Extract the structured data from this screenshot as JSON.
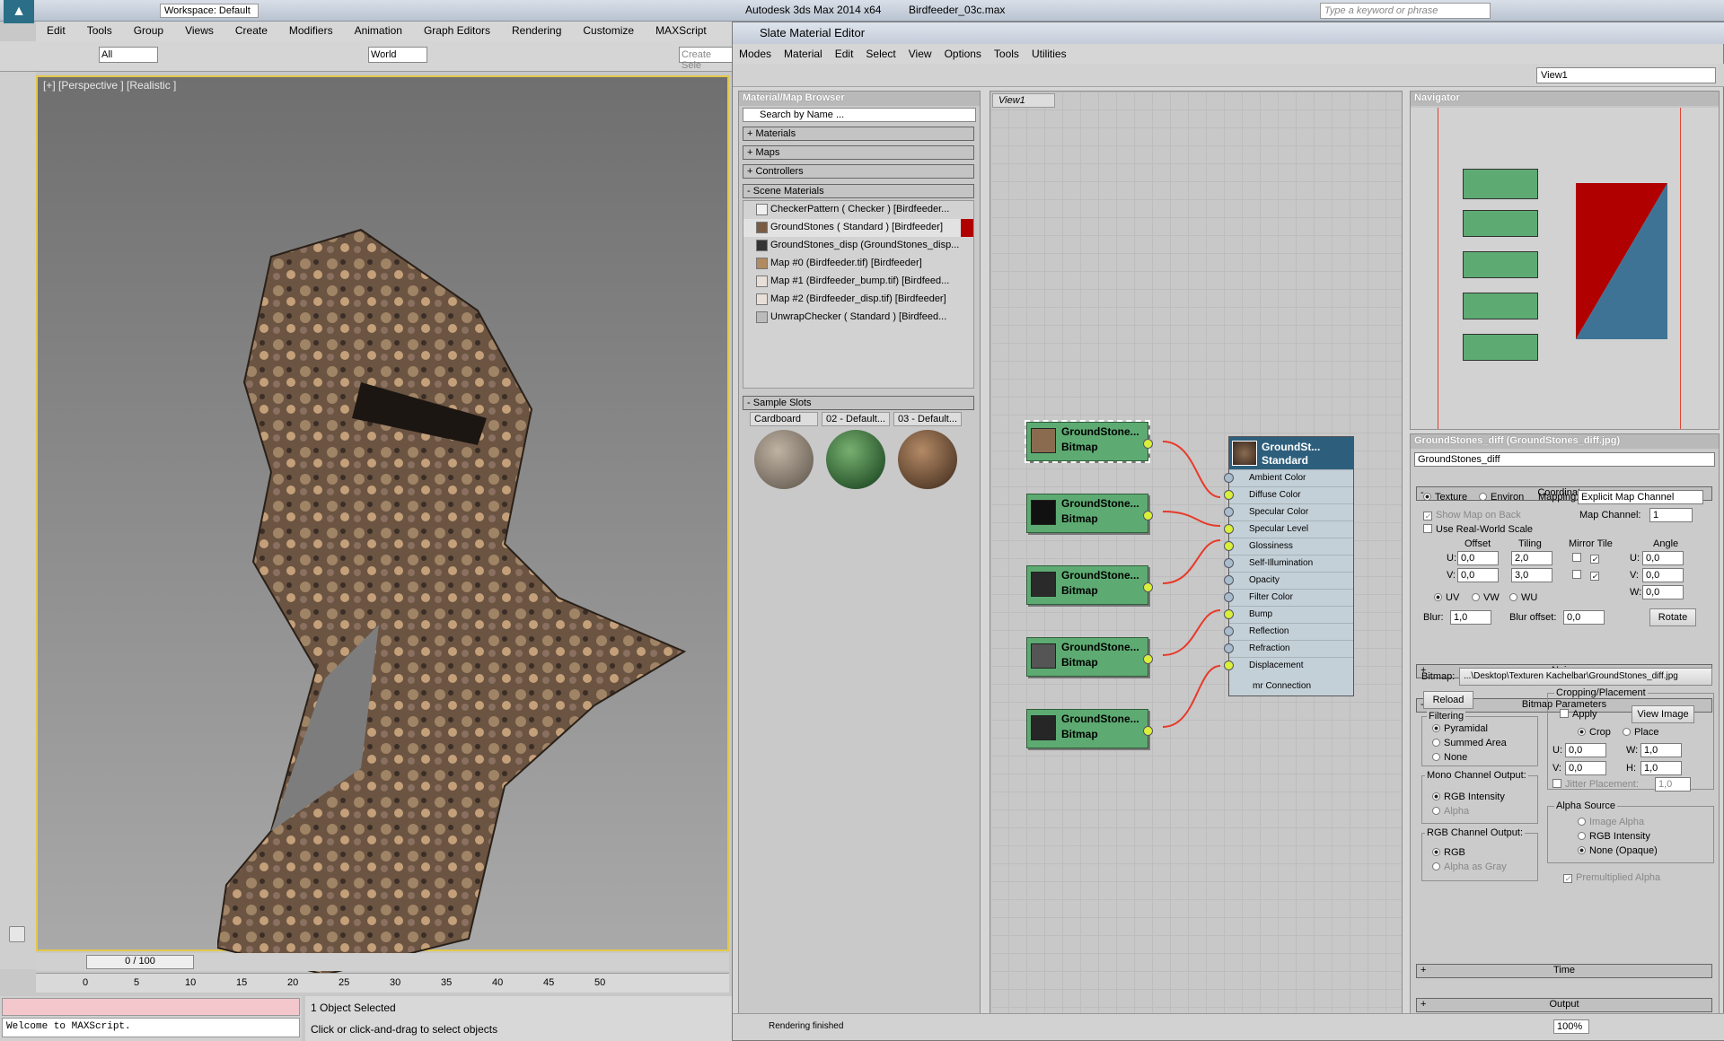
{
  "app": {
    "title": "Autodesk 3ds Max 2014 x64",
    "file": "Birdfeeder_03c.max",
    "workspace": "Workspace: Default",
    "search_placeholder": "Type a keyword or phrase",
    "menus": [
      "Edit",
      "Tools",
      "Group",
      "Views",
      "Create",
      "Modifiers",
      "Animation",
      "Graph Editors",
      "Rendering",
      "Customize",
      "MAXScript"
    ],
    "selection_filter": "All",
    "coord_system": "World",
    "create_selection": "Create Sele",
    "viewport_label": "[+] [Perspective ] [Realistic ]",
    "timeline": "0 / 100",
    "ruler_ticks": [
      "0",
      "5",
      "10",
      "15",
      "20",
      "25",
      "30",
      "35",
      "40",
      "45",
      "50"
    ],
    "maxscript_text": "Welcome to MAXScript.",
    "status_selected": "1 Object Selected",
    "status_prompt": "Click or click-and-drag to select objects"
  },
  "slate": {
    "title": "Slate Material Editor",
    "menus": [
      "Modes",
      "Material",
      "Edit",
      "Select",
      "View",
      "Options",
      "Tools",
      "Utilities"
    ],
    "view_select": "View1",
    "browser": {
      "title": "Material/Map Browser",
      "search": "Search by Name ...",
      "rollouts": [
        "Materials",
        "Maps",
        "Controllers"
      ],
      "scene_header": "Scene Materials",
      "scene_materials": [
        {
          "label": "CheckerPattern  ( Checker )  [Birdfeeder...",
          "color": "#f0f0f0"
        },
        {
          "label": "GroundStones  ( Standard )  [Birdfeeder]",
          "color": "#7a5c45"
        },
        {
          "label": "GroundStones_disp (GroundStones_disp...",
          "color": "#333333"
        },
        {
          "label": "Map #0 (Birdfeeder.tif)  [Birdfeeder]",
          "color": "#b08a60"
        },
        {
          "label": "Map #1 (Birdfeeder_bump.tif)  [Birdfeed...",
          "color": "#e8e0d8"
        },
        {
          "label": "Map #2 (Birdfeeder_disp.tif)  [Birdfeeder]",
          "color": "#e8e0d8"
        },
        {
          "label": "UnwrapChecker  ( Standard )  [Birdfeed...",
          "color": "#bbbbbb"
        }
      ],
      "sample_header": "Sample Slots",
      "sample_slots": [
        "Cardboard",
        "02 - Default...",
        "03 - Default..."
      ]
    },
    "view_tab": "View1",
    "bitmap_nodes": [
      {
        "name": "GroundStone...",
        "type": "Bitmap",
        "thumb": "#8a6b50"
      },
      {
        "name": "GroundStone...",
        "type": "Bitmap",
        "thumb": "#111111"
      },
      {
        "name": "GroundStone...",
        "type": "Bitmap",
        "thumb": "#2a2a2a"
      },
      {
        "name": "GroundStone...",
        "type": "Bitmap",
        "thumb": "#555555"
      },
      {
        "name": "GroundStone...",
        "type": "Bitmap",
        "thumb": "#262626"
      }
    ],
    "standard_node": {
      "name": "GroundSt...",
      "type": "Standard",
      "slots": [
        {
          "label": "Ambient Color",
          "on": false
        },
        {
          "label": "Diffuse Color",
          "on": true
        },
        {
          "label": "Specular Color",
          "on": false
        },
        {
          "label": "Specular Level",
          "on": true
        },
        {
          "label": "Glossiness",
          "on": true
        },
        {
          "label": "Self-Illumination",
          "on": false
        },
        {
          "label": "Opacity",
          "on": false
        },
        {
          "label": "Filter Color",
          "on": false
        },
        {
          "label": "Bump",
          "on": true
        },
        {
          "label": "Reflection",
          "on": false
        },
        {
          "label": "Refraction",
          "on": false
        },
        {
          "label": "Displacement",
          "on": true
        }
      ],
      "footer": "mr Connection"
    },
    "navigator_title": "Navigator",
    "params": {
      "title": "GroundStones_diff (GroundStones_diff.jpg)",
      "name": "GroundStones_diff",
      "coordinates": "Coordinates",
      "texture": "Texture",
      "environ": "Environ",
      "mapping_label": "Mapping:",
      "mapping": "Explicit Map Channel",
      "show_map": "Show Map on Back",
      "map_channel_label": "Map Channel:",
      "map_channel": "1",
      "real_world": "Use Real-World Scale",
      "offset": "Offset",
      "tiling": "Tiling",
      "mirror_tile": "Mirror Tile",
      "angle": "Angle",
      "u": "U:",
      "v": "V:",
      "w": "W:",
      "u_offset": "0,0",
      "v_offset": "0,0",
      "u_tiling": "2,0",
      "v_tiling": "3,0",
      "u_angle": "0,0",
      "v_angle": "0,0",
      "w_angle": "0,0",
      "uv": "UV",
      "vw": "VW",
      "wu": "WU",
      "blur_label": "Blur:",
      "blur": "1,0",
      "blur_offset_label": "Blur offset:",
      "blur_offset": "0,0",
      "rotate": "Rotate",
      "noise": "Noise",
      "bitmap_params": "Bitmap Parameters",
      "bitmap_label": "Bitmap:",
      "bitmap_path": "...\\Desktop\\Texturen Kachelbar\\GroundStones_diff.jpg",
      "reload": "Reload",
      "cropping": "Cropping/Placement",
      "apply": "Apply",
      "view_image": "View Image",
      "crop": "Crop",
      "place": "Place",
      "cu": "0,0",
      "cv": "0,0",
      "cw": "1,0",
      "ch": "1,0",
      "w_label": "W:",
      "h_label": "H:",
      "jitter": "Jitter Placement:",
      "jitter_val": "1,0",
      "filtering": "Filtering",
      "pyramidal": "Pyramidal",
      "summed": "Summed Area",
      "none": "None",
      "mono": "Mono Channel Output:",
      "rgb_int": "RGB Intensity",
      "alpha": "Alpha",
      "rgb_out": "RGB Channel Output:",
      "rgb": "RGB",
      "alpha_gray": "Alpha as Gray",
      "alpha_source": "Alpha Source",
      "image_alpha": "Image Alpha",
      "rgb_int2": "RGB Intensity",
      "none_opaque": "None (Opaque)",
      "premult": "Premultiplied Alpha",
      "time": "Time",
      "output": "Output"
    },
    "status": "Rendering finished",
    "zoom": "100%"
  },
  "colors": {
    "node_green": "#5dab72",
    "node_header": "#2d5f7d",
    "accent_red": "#b00000",
    "viewport_border": "#e3c84a"
  }
}
